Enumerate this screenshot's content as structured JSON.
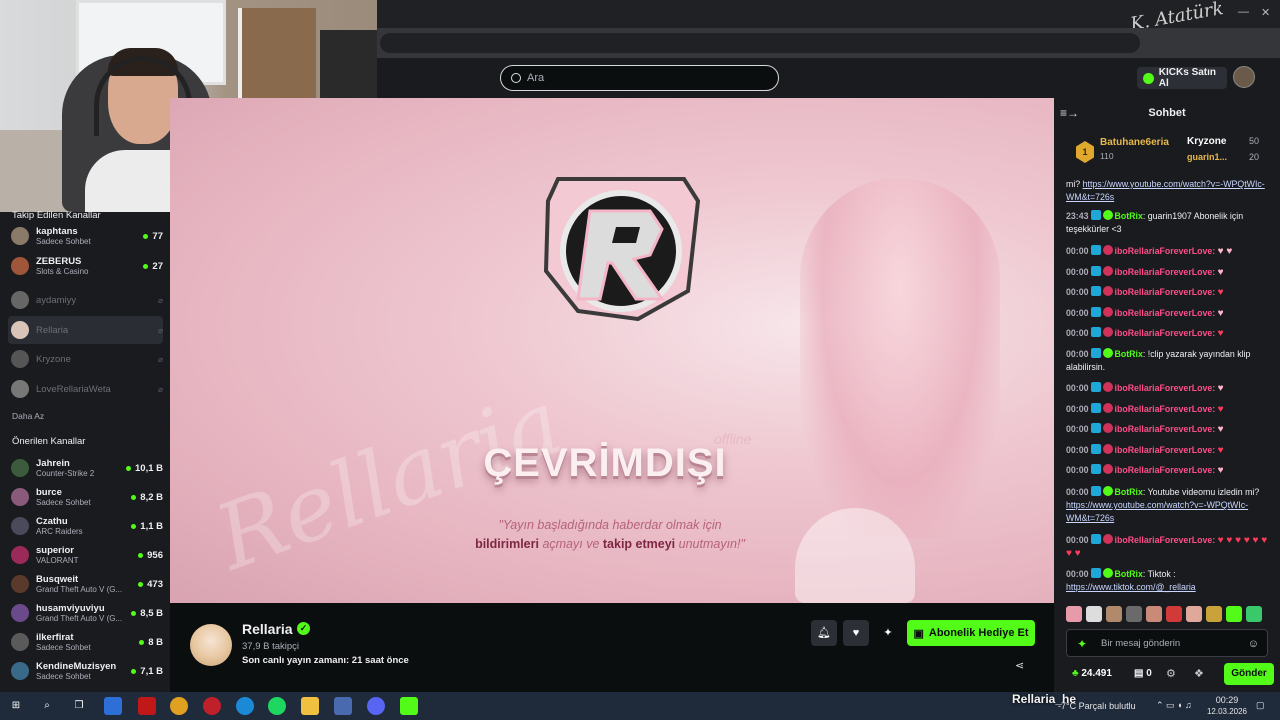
{
  "top": {
    "search_placeholder": "Ara",
    "kicks_label": "KICKs Satın Al",
    "signature": "K. Atatürk"
  },
  "sidebar": {
    "followed_heading": "Takip Edilen Kanallar",
    "followed": [
      {
        "name": "kaphtans",
        "sub": "Sadece Sohbet",
        "count": "77",
        "live": true,
        "color": "#8a7a6a"
      },
      {
        "name": "ZEBERUS",
        "sub": "Slots & Casino",
        "count": "27",
        "live": true,
        "color": "#a0563a"
      },
      {
        "name": "aydamiyy",
        "sub": "",
        "count": "",
        "live": false,
        "color": "#666"
      },
      {
        "name": "Rellaria",
        "sub": "",
        "count": "",
        "live": false,
        "color": "#d9c4b8"
      },
      {
        "name": "Kryzone",
        "sub": "",
        "count": "",
        "live": false,
        "color": "#555"
      },
      {
        "name": "LoveRellariaWeta",
        "sub": "",
        "count": "",
        "live": false,
        "color": "#777"
      }
    ],
    "less_label": "Daha Az",
    "suggested_heading": "Önerilen Kanallar",
    "suggested": [
      {
        "name": "Jahrein",
        "sub": "Counter-Strike 2",
        "count": "10,1 B",
        "color": "#3c5a3c"
      },
      {
        "name": "burce",
        "sub": "Sadece Sohbet",
        "count": "8,2 B",
        "color": "#8a5a7a"
      },
      {
        "name": "Czathu",
        "sub": "ARC Raiders",
        "count": "1,1 B",
        "color": "#4a4a5a"
      },
      {
        "name": "superior",
        "sub": "VALORANT",
        "count": "956",
        "color": "#9a2a5a"
      },
      {
        "name": "Busqweit",
        "sub": "Grand Theft Auto V (G...",
        "count": "473",
        "color": "#5a3a2a"
      },
      {
        "name": "husamviyuviyu",
        "sub": "Grand Theft Auto V (G...",
        "count": "8,5 B",
        "color": "#6a4a8a"
      },
      {
        "name": "ilkerfirat",
        "sub": "Sadece Sohbet",
        "count": "8 B",
        "color": "#5a5a5a"
      },
      {
        "name": "KendineMuzisyen",
        "sub": "Sadece Sohbet",
        "count": "7,1 B",
        "color": "#3a6a8a"
      }
    ]
  },
  "player": {
    "offline_tag": "offline",
    "offline_title": "ÇEVRİMDIŞI",
    "notice_line1": "\"Yayın başladığında haberdar olmak için",
    "notice_bold1": "bildirimleri",
    "notice_mid": " açmayı ve ",
    "notice_bold2": "takip etmeyi",
    "notice_end": " unutmayın!\"",
    "watermark": "Rellaria"
  },
  "channel": {
    "name": "Rellaria",
    "followers": "37,9 B takipçi",
    "last_live": "Son canlı yayın zamanı: 21 saat önce",
    "subscribe_gift_label": "Abonelik Hediye Et"
  },
  "chat": {
    "title": "Sohbet",
    "leaderboard": {
      "first_rank": "1",
      "first_user": "Batuhane6eria",
      "first_value": "110",
      "second_user": "Kryzone",
      "second_value": "50",
      "third_user": "guarin1...",
      "third_value": "20"
    },
    "messages": [
      {
        "kind": "link",
        "pre": "mi? ",
        "link": "https://www.youtube.com/watch?v=-WPQtWIc-WM&t=726s"
      },
      {
        "kind": "bot",
        "time": "23:43",
        "user": "BotRix",
        "text": "guarin1907 Abonelik için teşekkürler <3"
      },
      {
        "kind": "ibo",
        "time": "00:00",
        "user": "iboRellariaForeverLove:",
        "hearts": "♥ ♥"
      },
      {
        "kind": "ibo",
        "time": "00:00",
        "user": "iboRellariaForeverLove:",
        "hearts": "♥"
      },
      {
        "kind": "ibo",
        "time": "00:00",
        "user": "iboRellariaForeverLove:",
        "hearts": "♥"
      },
      {
        "kind": "ibo",
        "time": "00:00",
        "user": "iboRellariaForeverLove:",
        "hearts": "♥"
      },
      {
        "kind": "ibo",
        "time": "00:00",
        "user": "iboRellariaForeverLove:",
        "hearts": "♥"
      },
      {
        "kind": "bot",
        "time": "00:00",
        "user": "BotRix",
        "text": "!clip yazarak yayından klip alabilirsin."
      },
      {
        "kind": "ibo",
        "time": "00:00",
        "user": "iboRellariaForeverLove:",
        "hearts": "♥"
      },
      {
        "kind": "ibo",
        "time": "00:00",
        "user": "iboRellariaForeverLove:",
        "hearts": "♥"
      },
      {
        "kind": "ibo",
        "time": "00:00",
        "user": "iboRellariaForeverLove:",
        "hearts": "♥"
      },
      {
        "kind": "ibo",
        "time": "00:00",
        "user": "iboRellariaForeverLove:",
        "hearts": "♥"
      },
      {
        "kind": "ibo",
        "time": "00:00",
        "user": "iboRellariaForeverLove:",
        "hearts": "♥"
      },
      {
        "kind": "bot",
        "time": "00:00",
        "user": "BotRix",
        "text": "Youtube videomu izledin mi?",
        "link": "https://www.youtube.com/watch?v=-WPQtWIc-WM&t=726s"
      },
      {
        "kind": "ibo",
        "time": "00:00",
        "user": "iboRellariaForeverLove:",
        "hearts": "♥ ♥ ♥ ♥ ♥ ♥ ♥ ♥"
      },
      {
        "kind": "bot",
        "time": "00:00",
        "user": "BotRix",
        "text": "Tiktok :",
        "link": "https://www.tiktok.com/@_rellaria"
      }
    ],
    "input_placeholder": "Bir mesaj gönderin",
    "points": "24.491",
    "zero": "0",
    "send_label": "Gönder"
  },
  "taskbar": {
    "overlay_text": "Rellaria_he",
    "weather": "-7°C  Parçalı bulutlu",
    "time": "00:29",
    "date": "12.03.2026"
  }
}
